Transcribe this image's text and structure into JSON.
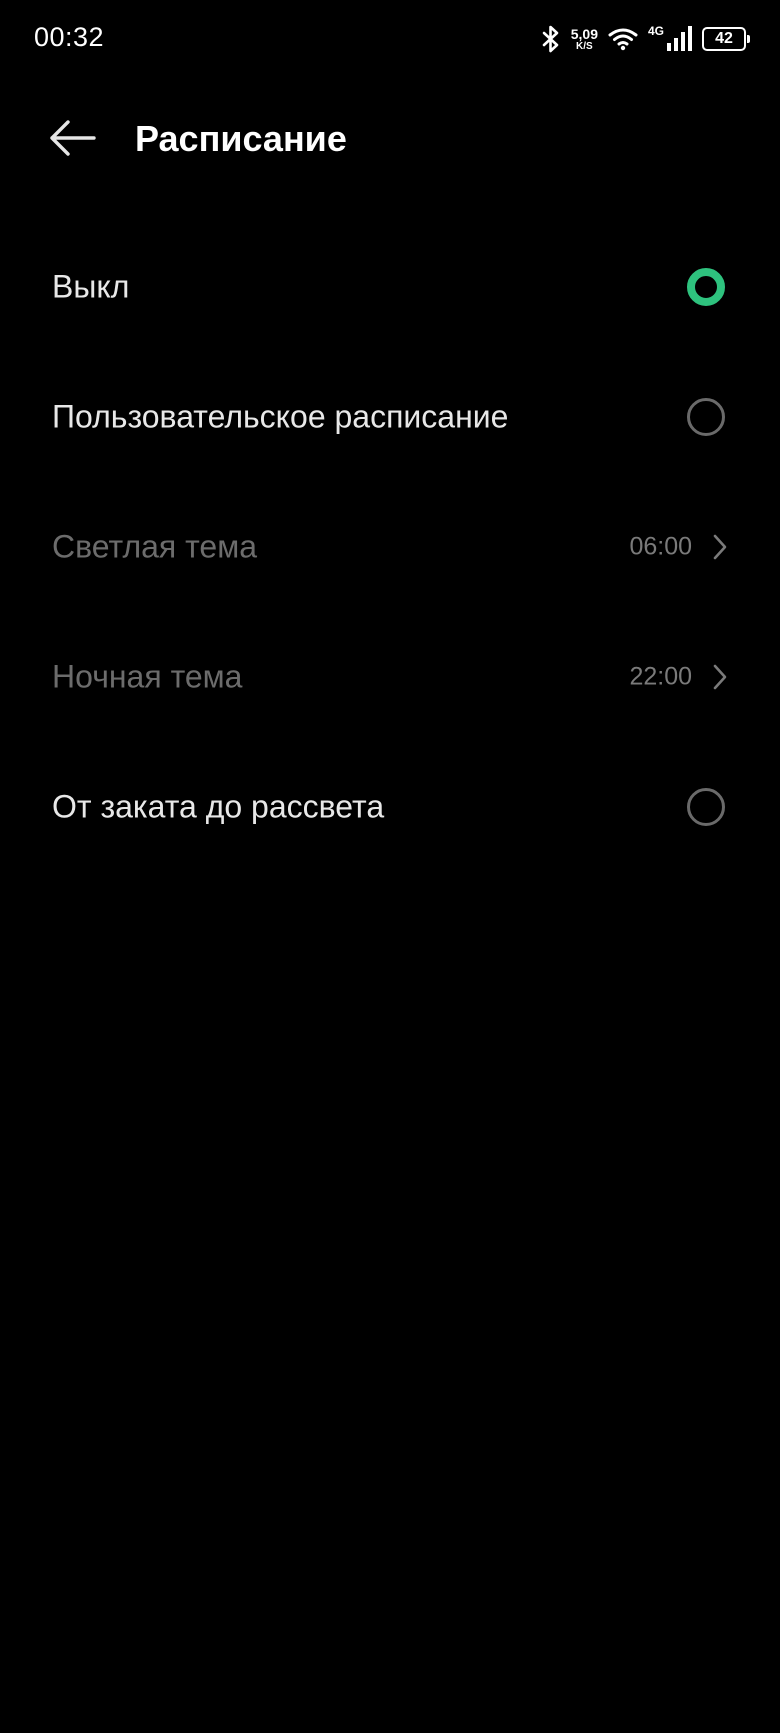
{
  "status_bar": {
    "time": "00:32",
    "speed_value": "5,09",
    "speed_unit": "K/S",
    "network": "4G",
    "battery": "42"
  },
  "header": {
    "title": "Расписание",
    "back_icon": "arrow-left-icon"
  },
  "options": [
    {
      "label": "Выкл",
      "control": "radio",
      "selected": true
    },
    {
      "label": "Пользовательское расписание",
      "control": "radio",
      "selected": false
    },
    {
      "label": "Светлая тема",
      "value": "06:00",
      "control": "chevron",
      "enabled": false
    },
    {
      "label": "Ночная тема",
      "value": "22:00",
      "control": "chevron",
      "enabled": false
    },
    {
      "label": "От заката до рассвета",
      "control": "radio",
      "selected": false
    }
  ],
  "colors": {
    "background": "#000000",
    "accent": "#2ec27e",
    "text_primary": "#e8e8e8",
    "text_disabled": "#6c6c6c"
  }
}
